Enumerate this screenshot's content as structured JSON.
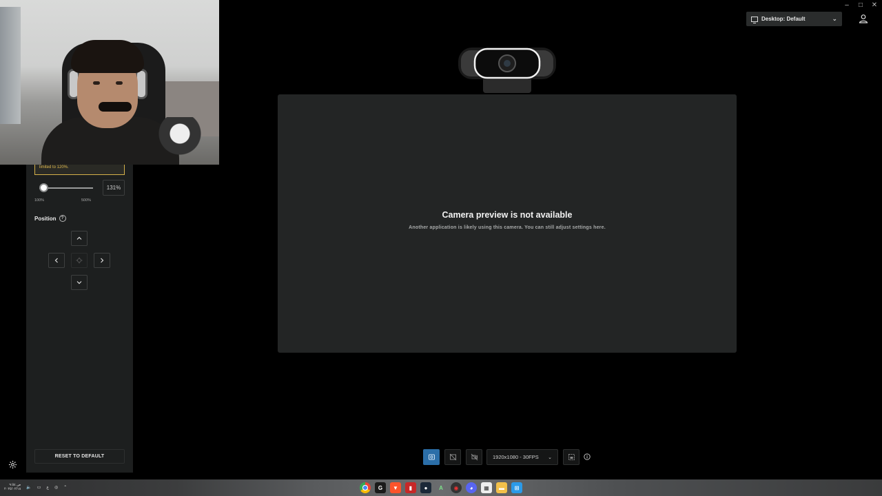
{
  "window": {
    "controls": {
      "minimize": "–",
      "maximize": "□",
      "close": "✕"
    }
  },
  "header": {
    "profile_label": "Desktop: Default",
    "profile_chevron": "⌄"
  },
  "panel": {
    "warning_text": "limited to 120%.",
    "zoom": {
      "min_label": "100%",
      "max_label": "500%",
      "value_label": "131%",
      "value_percent": 131,
      "min": 100,
      "max": 500
    },
    "position_label": "Position",
    "help_glyph": "?",
    "reset_label": "RESET TO DEFAULT"
  },
  "preview": {
    "title": "Camera preview is not available",
    "subtitle": "Another application is likely using this camera. You can still adjust settings here."
  },
  "toolbar": {
    "resolution_label": "1920x1080 - 30FPS",
    "resolution_chevron": "⌄"
  },
  "taskbar": {
    "date_line1": "ص ٩:٥٤",
    "date_line2": "٢٠٢٥/٠٢/١٨",
    "lang": "ع",
    "apps": [
      "chrome-icon",
      "logitech-icon",
      "brave-icon",
      "app-red-icon",
      "steam-icon",
      "app-a-icon",
      "app-record-icon",
      "discord-icon",
      "app-calendar-icon",
      "folder-icon",
      "store-icon"
    ]
  },
  "colors": {
    "accent": "#2b6ea8",
    "warning": "#d6b24a",
    "panel_bg": "#1d1f1f",
    "preview_bg": "#232525"
  }
}
